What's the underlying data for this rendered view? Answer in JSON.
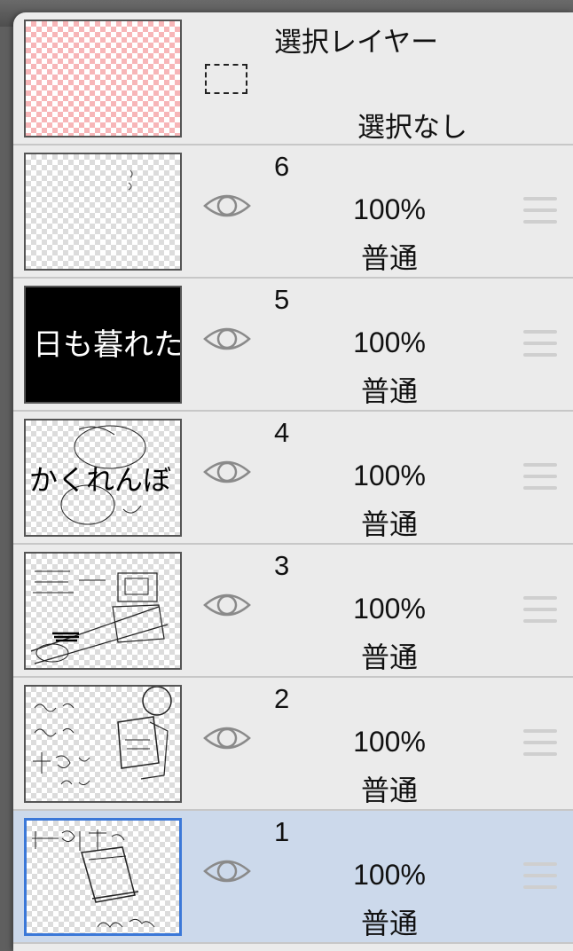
{
  "selection_layer": {
    "title": "選択レイヤー",
    "status": "選択なし"
  },
  "layers": [
    {
      "name": "6",
      "opacity": "100%",
      "blend": "普通",
      "visible": true,
      "selected": false
    },
    {
      "name": "5",
      "opacity": "100%",
      "blend": "普通",
      "visible": true,
      "selected": false,
      "thumbnail_text": "日も暮れた"
    },
    {
      "name": "4",
      "opacity": "100%",
      "blend": "普通",
      "visible": true,
      "selected": false,
      "thumbnail_text": "かくれんぼ"
    },
    {
      "name": "3",
      "opacity": "100%",
      "blend": "普通",
      "visible": true,
      "selected": false
    },
    {
      "name": "2",
      "opacity": "100%",
      "blend": "普通",
      "visible": true,
      "selected": false
    },
    {
      "name": "1",
      "opacity": "100%",
      "blend": "普通",
      "visible": true,
      "selected": true
    }
  ],
  "colors": {
    "panel_bg": "#ebebeb",
    "selected_row_bg": "#ccd9eb",
    "selected_thumb_border": "#3b78d8",
    "selection_checker": "#f7b6b8"
  },
  "icons": {
    "visibility": "eye-icon",
    "reorder": "drag-handle-icon",
    "selection": "dashed-marquee-icon"
  }
}
